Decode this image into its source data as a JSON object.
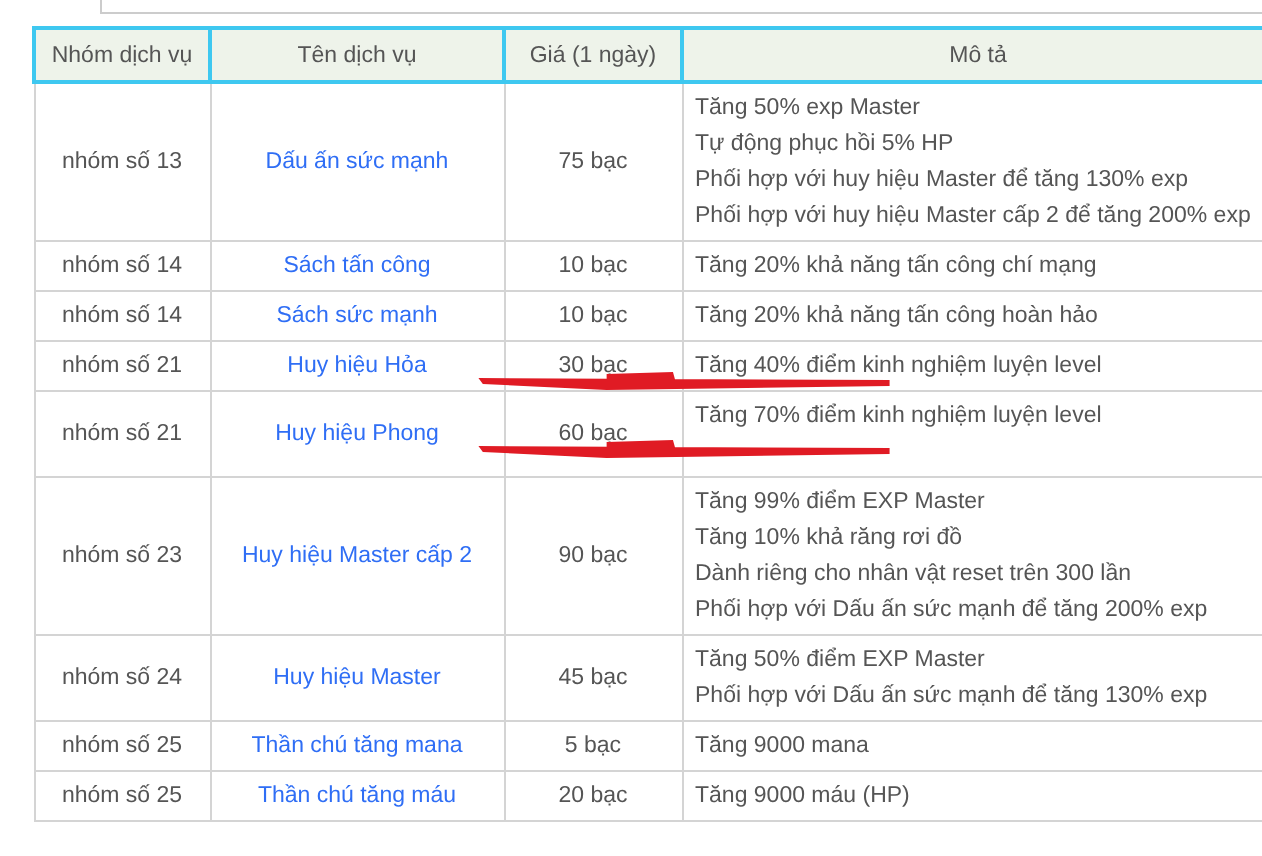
{
  "columns": [
    "Nhóm dịch vụ",
    "Tên dịch vụ",
    "Giá (1 ngày)",
    "Mô tả"
  ],
  "rows": [
    {
      "group": "nhóm số 13",
      "name": "Dấu ấn sức mạnh",
      "price": "75 bạc",
      "description": [
        "Tăng 50% exp Master",
        "Tự động phục hồi 5% HP",
        "Phối hợp với huy hiệu Master để tăng 130% exp",
        "Phối hợp với huy hiệu Master cấp 2 để tăng 200% exp"
      ],
      "scribbled": false
    },
    {
      "group": "nhóm số 14",
      "name": "Sách tấn công",
      "price": "10 bạc",
      "description": [
        "Tăng 20% khả năng tấn công chí mạng"
      ],
      "scribbled": false
    },
    {
      "group": "nhóm số 14",
      "name": "Sách sức mạnh",
      "price": "10 bạc",
      "description": [
        "Tăng 20% khả năng tấn công hoàn hảo"
      ],
      "scribbled": false
    },
    {
      "group": "nhóm số 21",
      "name": "Huy hiệu Hỏa",
      "price": "30 bạc",
      "description": [
        "Tăng 40% điểm kinh nghiệm luyện level"
      ],
      "scribbled": true
    },
    {
      "group": "nhóm số 21",
      "name": "Huy hiệu Phong",
      "price": "60 bạc",
      "description": [
        "Tăng 70% điểm kinh nghiệm luyện level"
      ],
      "scribbled": true
    },
    {
      "group": "nhóm số 23",
      "name": "Huy hiệu Master cấp 2",
      "price": "90 bạc",
      "description": [
        "Tăng 99% điểm EXP Master",
        "Tăng 10% khả răng rơi đồ",
        "Dành riêng cho nhân vật reset trên 300 lần",
        "Phối hợp với Dấu ấn sức mạnh để tăng 200% exp"
      ],
      "scribbled": false
    },
    {
      "group": "nhóm số 24",
      "name": "Huy hiệu Master",
      "price": "45 bạc",
      "description": [
        "Tăng 50% điểm EXP Master",
        "Phối hợp với Dấu ấn sức mạnh để tăng 130% exp"
      ],
      "scribbled": false
    },
    {
      "group": "nhóm số 25",
      "name": "Thần chú tăng mana",
      "price": "5 bạc",
      "description": [
        "Tăng 9000 mana"
      ],
      "scribbled": false
    },
    {
      "group": "nhóm số 25",
      "name": "Thần chú tăng máu",
      "price": "20 bạc",
      "description": [
        "Tăng 9000 máu (HP)"
      ],
      "scribbled": false
    }
  ]
}
